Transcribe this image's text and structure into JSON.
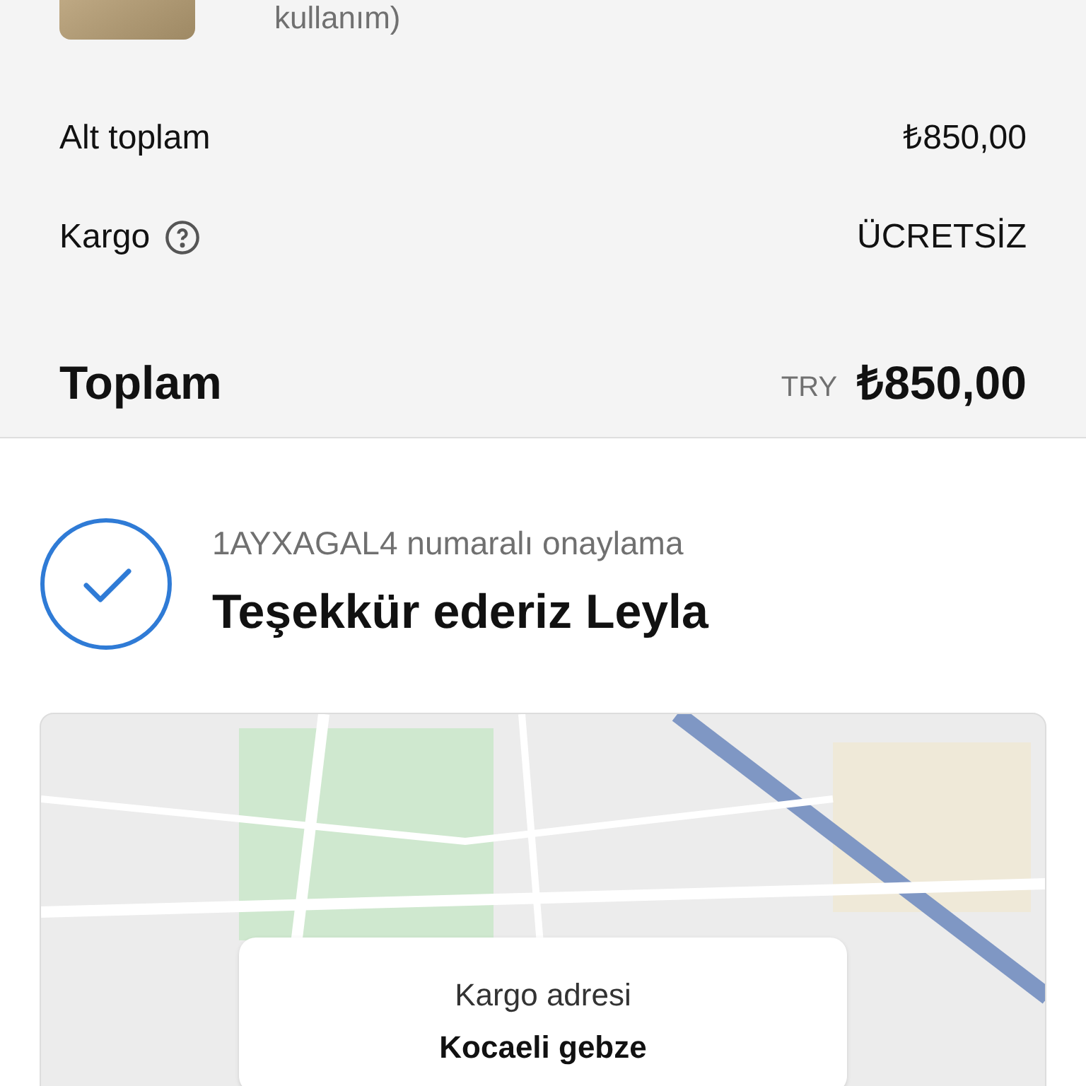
{
  "product": {
    "description_tail": "kullanım)"
  },
  "summary": {
    "subtotal_label": "Alt toplam",
    "subtotal_value": "₺850,00",
    "shipping_label": "Kargo",
    "shipping_value": "ÜCRETSİZ",
    "total_label": "Toplam",
    "currency": "TRY",
    "total_value": "₺850,00"
  },
  "confirmation": {
    "number_text": "1AYXAGAL4 numaralı onaylama",
    "title": "Teşekkür ederiz Leyla"
  },
  "map_card": {
    "label": "Kargo adresi",
    "address": "Kocaeli gebze"
  }
}
